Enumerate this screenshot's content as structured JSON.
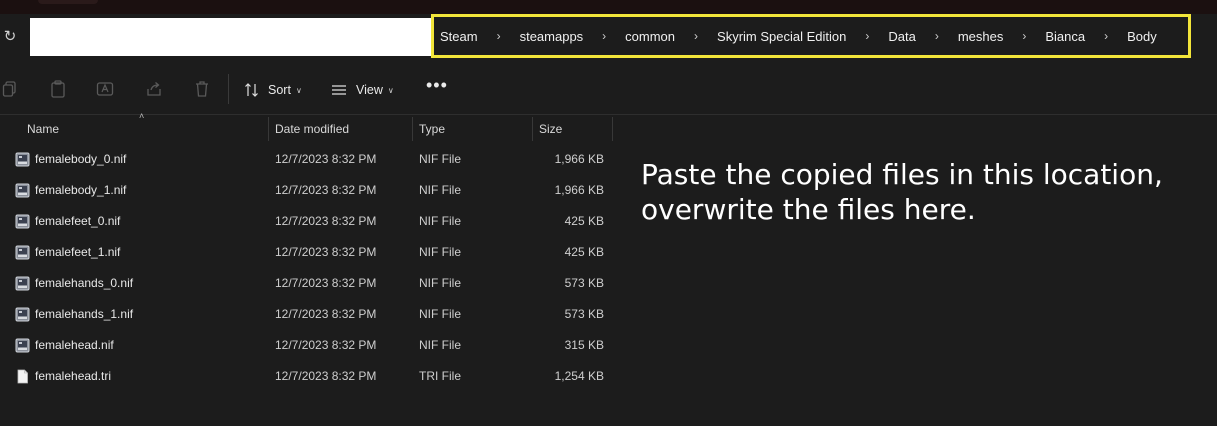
{
  "breadcrumb": [
    "Steam",
    "steamapps",
    "common",
    "Skyrim Special Edition",
    "Data",
    "meshes",
    "Bianca",
    "Body"
  ],
  "address_value": "",
  "toolbar": {
    "sort_label": "Sort",
    "view_label": "View",
    "more_label": "•••"
  },
  "columns": {
    "name": "Name",
    "date": "Date modified",
    "type": "Type",
    "size": "Size"
  },
  "files": [
    {
      "name": "femalebody_0.nif",
      "date": "12/7/2023 8:32 PM",
      "type": "NIF File",
      "size": "1,966 KB",
      "icon": "nif-file-icon"
    },
    {
      "name": "femalebody_1.nif",
      "date": "12/7/2023 8:32 PM",
      "type": "NIF File",
      "size": "1,966 KB",
      "icon": "nif-file-icon"
    },
    {
      "name": "femalefeet_0.nif",
      "date": "12/7/2023 8:32 PM",
      "type": "NIF File",
      "size": "425 KB",
      "icon": "nif-file-icon"
    },
    {
      "name": "femalefeet_1.nif",
      "date": "12/7/2023 8:32 PM",
      "type": "NIF File",
      "size": "425 KB",
      "icon": "nif-file-icon"
    },
    {
      "name": "femalehands_0.nif",
      "date": "12/7/2023 8:32 PM",
      "type": "NIF File",
      "size": "573 KB",
      "icon": "nif-file-icon"
    },
    {
      "name": "femalehands_1.nif",
      "date": "12/7/2023 8:32 PM",
      "type": "NIF File",
      "size": "573 KB",
      "icon": "nif-file-icon"
    },
    {
      "name": "femalehead.nif",
      "date": "12/7/2023 8:32 PM",
      "type": "NIF File",
      "size": "315 KB",
      "icon": "nif-file-icon"
    },
    {
      "name": "femalehead.tri",
      "date": "12/7/2023 8:32 PM",
      "type": "TRI File",
      "size": "1,254 KB",
      "icon": "blank-file-icon"
    }
  ],
  "annotation": {
    "line1": "Paste the copied files in this location,",
    "line2": "overwrite the files here."
  },
  "colors": {
    "highlight": "#f2e53a",
    "background": "#1c1c1c"
  }
}
